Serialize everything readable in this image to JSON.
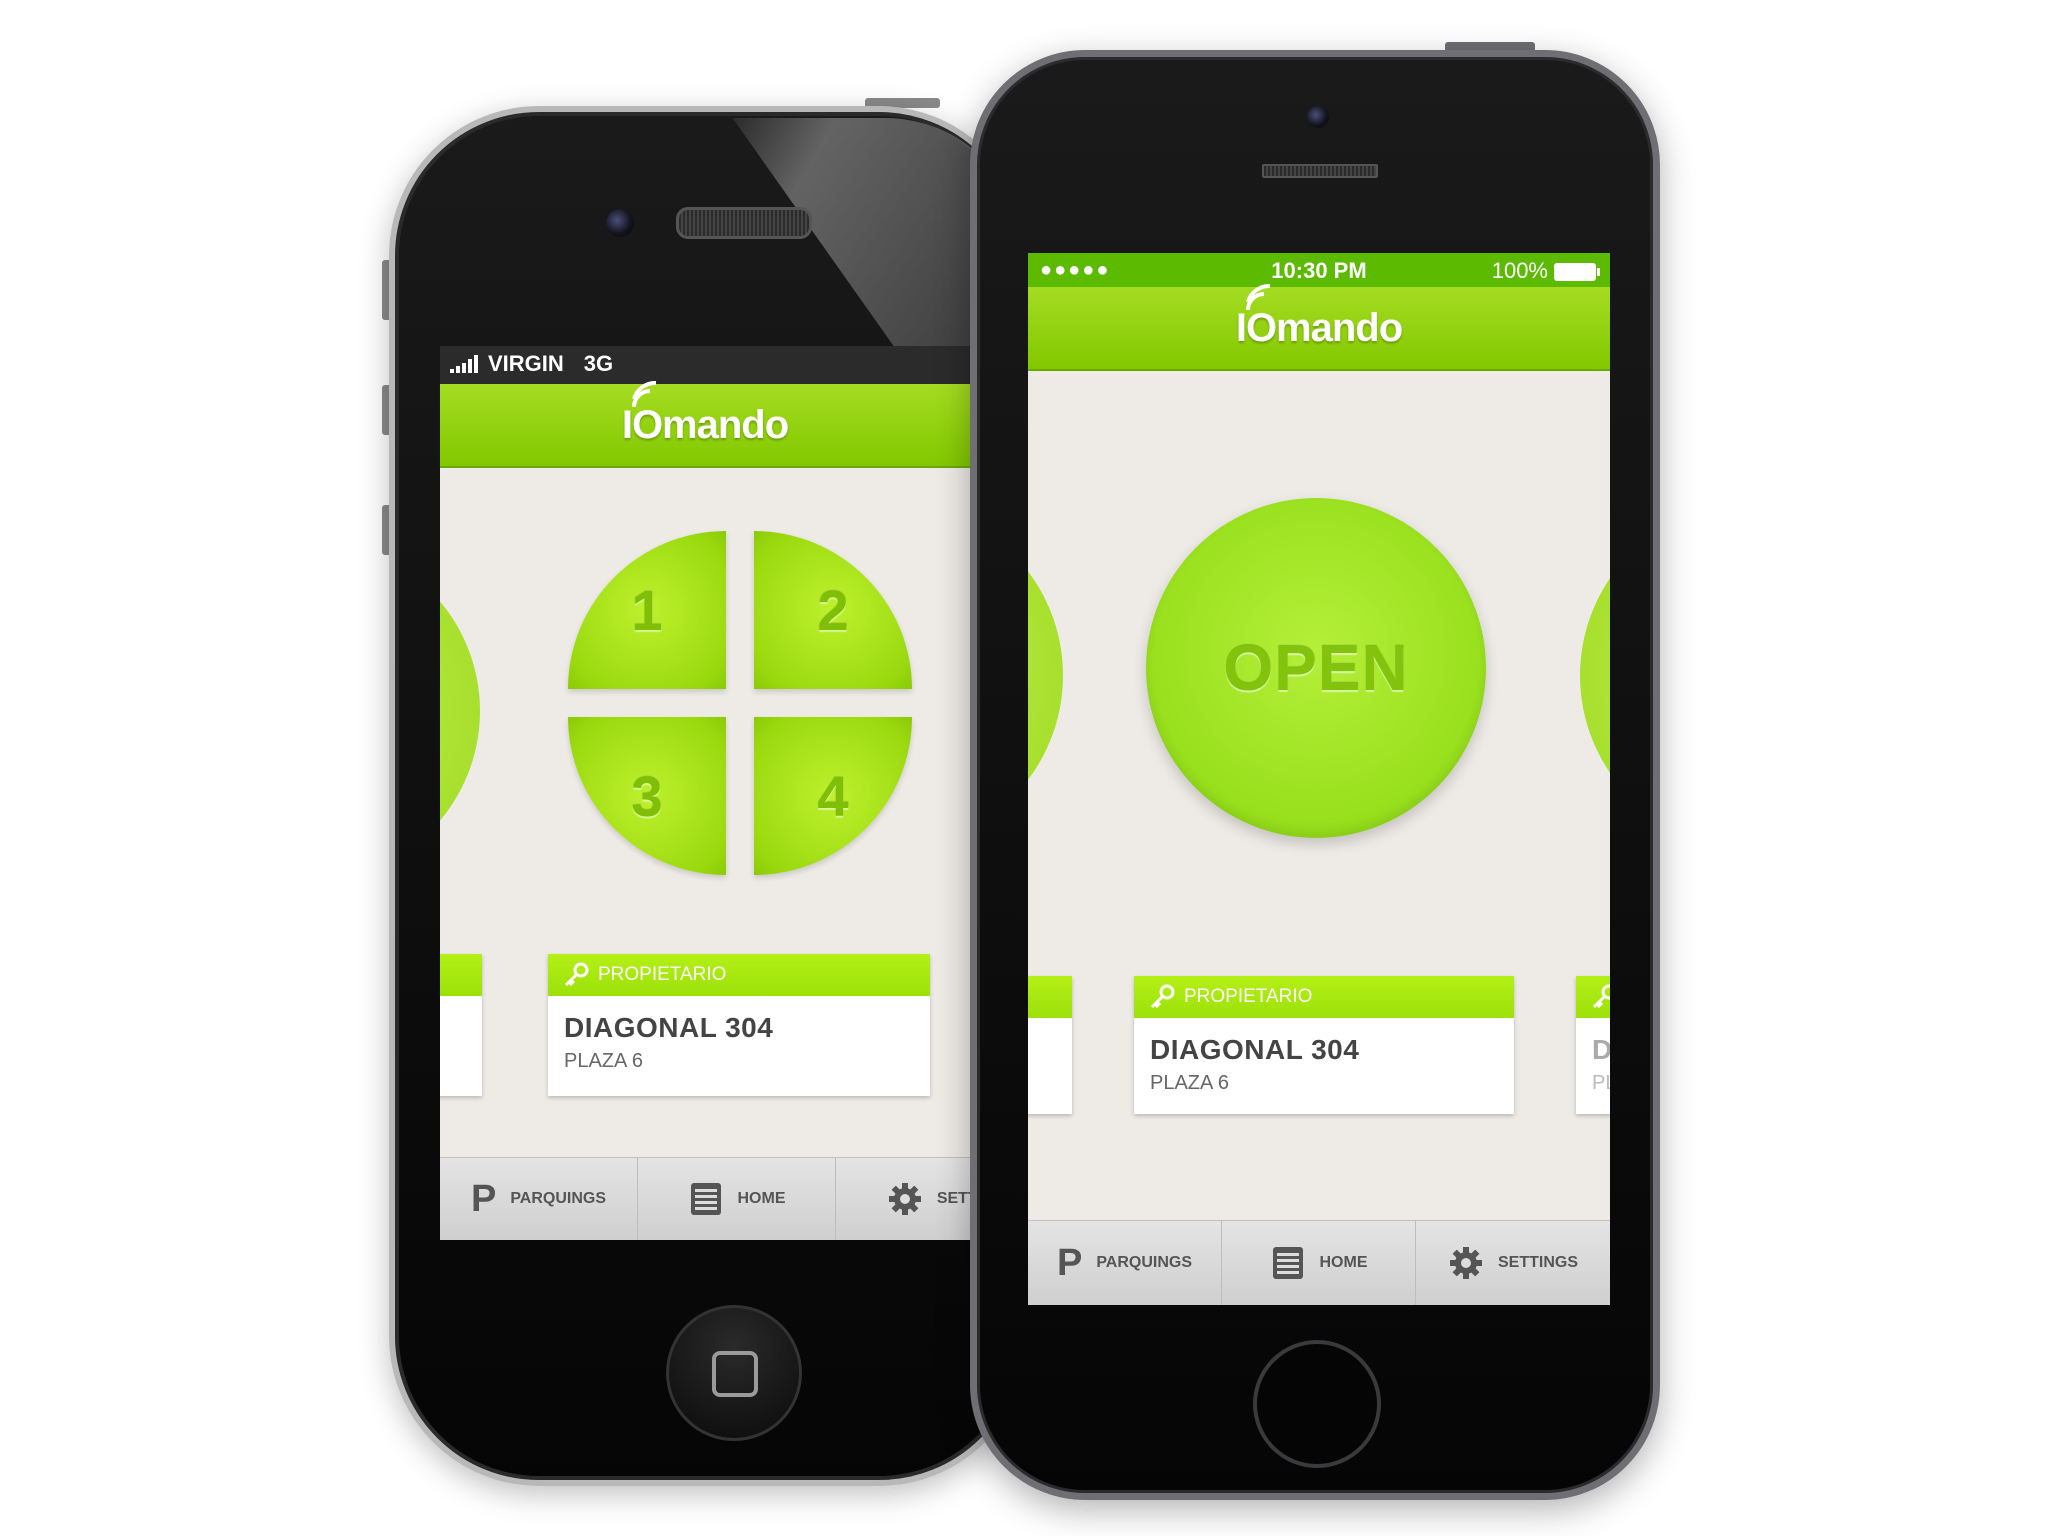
{
  "left_phone": {
    "status": {
      "carrier": "VIRGIN",
      "network": "3G"
    },
    "app": {
      "logo": "IOmando"
    },
    "quad_buttons": [
      "1",
      "2",
      "3",
      "4"
    ],
    "card": {
      "role": "PROPIETARIO",
      "title": "DIAGONAL 304",
      "subtitle": "PLAZA 6"
    },
    "tabs": [
      {
        "label": "PARQUINGS",
        "icon": "parking-icon"
      },
      {
        "label": "HOME",
        "icon": "garage-door-icon"
      },
      {
        "label": "SETTI",
        "icon": "gear-icon"
      }
    ]
  },
  "right_phone": {
    "status": {
      "signal_dots": "●●●●●",
      "time": "10:30 PM",
      "battery": "100%"
    },
    "app": {
      "logo": "IOmando"
    },
    "open_button": {
      "label": "OPEN"
    },
    "card": {
      "role": "PROPIETARIO",
      "title": "DIAGONAL 304",
      "subtitle": "PLAZA 6"
    },
    "next_card": {
      "title": "DI",
      "subtitle": "PL/"
    },
    "tabs": [
      {
        "label": "PARQUINGS",
        "icon": "parking-icon"
      },
      {
        "label": "HOME",
        "icon": "garage-door-icon"
      },
      {
        "label": "SETTINGS",
        "icon": "gear-icon"
      }
    ]
  },
  "colors": {
    "brand_green": "#8fd400",
    "status_green": "#5cba00",
    "button_green": "#a3e42a",
    "background": "#eeebe7"
  }
}
